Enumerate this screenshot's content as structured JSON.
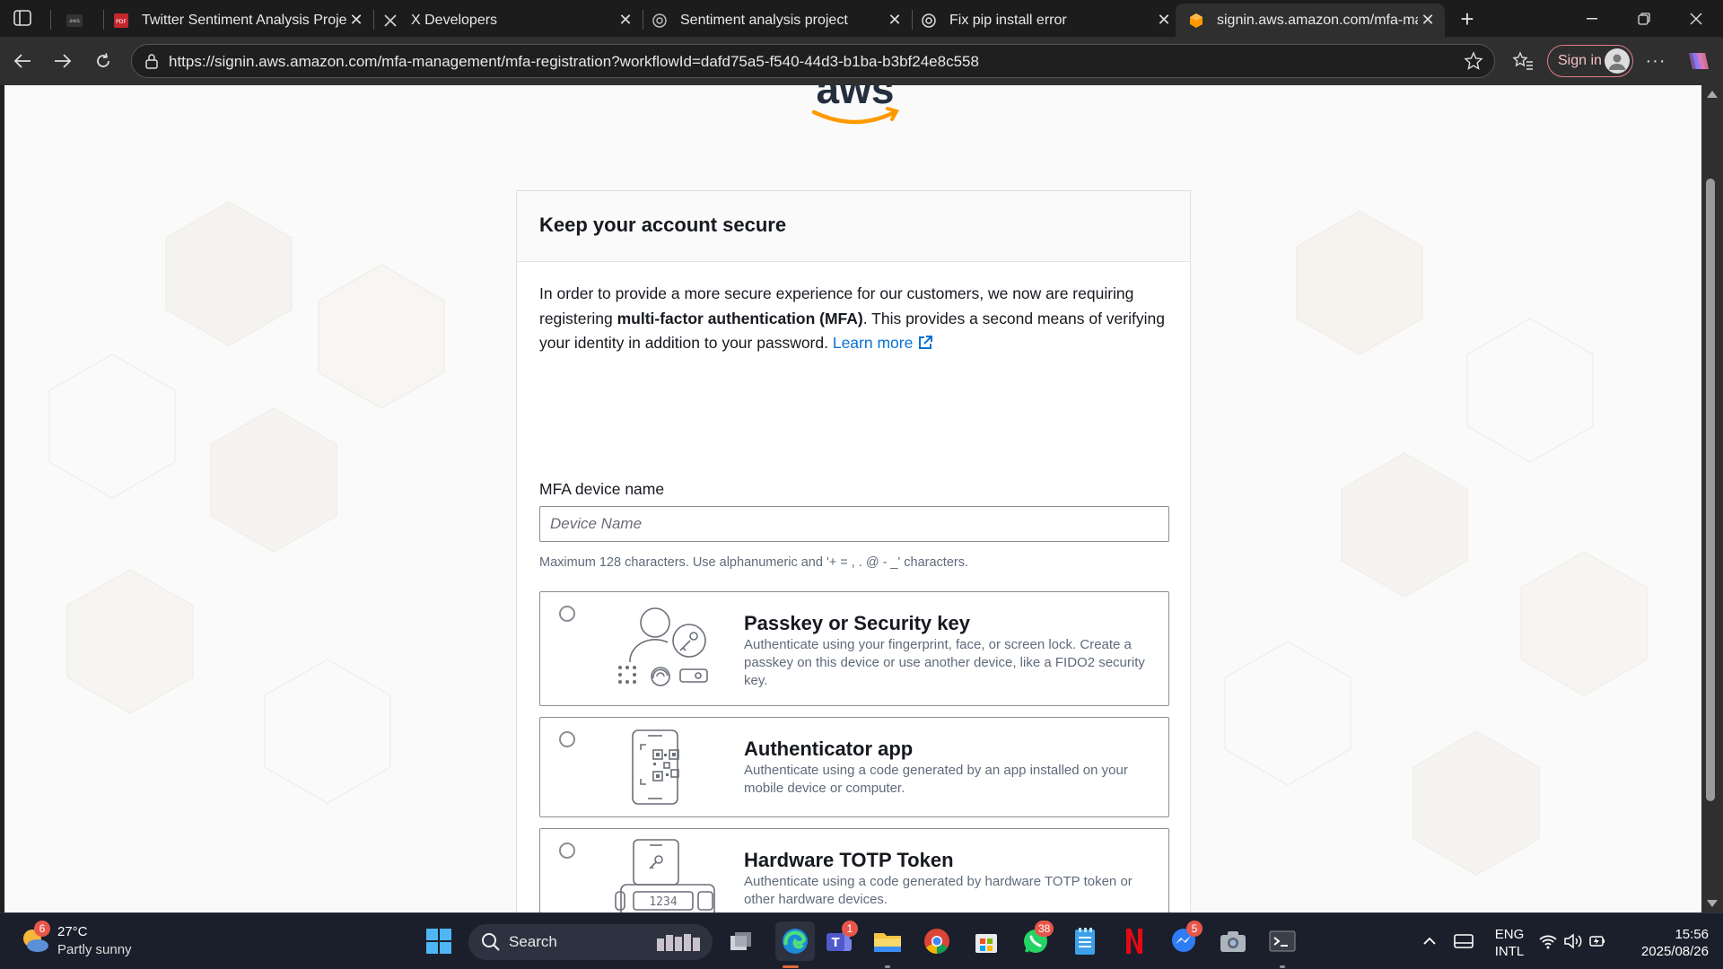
{
  "browser": {
    "tabs": [
      {
        "title": "",
        "favicon": "aws-favicon",
        "active": false
      },
      {
        "title": "Twitter Sentiment Analysis Project",
        "favicon": "pdf-icon",
        "active": false
      },
      {
        "title": "X Developers",
        "favicon": "x-logo-icon",
        "active": false
      },
      {
        "title": "Sentiment analysis project",
        "favicon": "chatgpt-icon",
        "active": false
      },
      {
        "title": "Fix pip install error",
        "favicon": "chatgpt-icon",
        "active": false
      },
      {
        "title": "signin.aws.amazon.com/mfa-management/mfa-registration",
        "favicon": "aws-favicon",
        "active": true
      }
    ],
    "url": "https://signin.aws.amazon.com/mfa-management/mfa-registration?workflowId=dafd75a5-f540-44d3-b1ba-b3bf24e8c558",
    "signin_label": "Sign in"
  },
  "page": {
    "logo_text": "aws",
    "card_title": "Keep your account secure",
    "intro_part1": "In order to provide a more secure experience for our customers, we now are requiring registering ",
    "intro_bold": "multi-factor authentication (MFA)",
    "intro_part2": ". This provides a second means of verifying your identity in addition to your password. ",
    "learn_more": "Learn more",
    "device_label": "MFA device name",
    "device_placeholder": "Device Name",
    "device_hint": "Maximum 128 characters. Use alphanumeric and '+ = , . @ - _' characters.",
    "options": [
      {
        "title": "Passkey or Security key",
        "desc": "Authenticate using your fingerprint, face, or screen lock. Create a passkey on this device or use another device, like a FIDO2 security key.",
        "selected": false
      },
      {
        "title": "Authenticator app",
        "desc": "Authenticate using a code generated by an app installed on your mobile device or computer.",
        "selected": false
      },
      {
        "title": "Hardware TOTP Token",
        "desc": "Authenticate using a code generated by hardware TOTP token or other hardware devices.",
        "selected": false,
        "token_display": "1234"
      }
    ]
  },
  "taskbar": {
    "weather_badge": "6",
    "temperature": "27°C",
    "condition": "Partly sunny",
    "search_label": "Search",
    "teams_badge": "1",
    "whatsapp_badge": "38",
    "messenger_badge": "5",
    "lang_line1": "ENG",
    "lang_line2": "INTL",
    "time": "15:56",
    "date": "2025/08/26"
  },
  "colors": {
    "aws_orange": "#ff9900",
    "link_blue": "#0972d3",
    "signin_border": "#e07b85"
  }
}
